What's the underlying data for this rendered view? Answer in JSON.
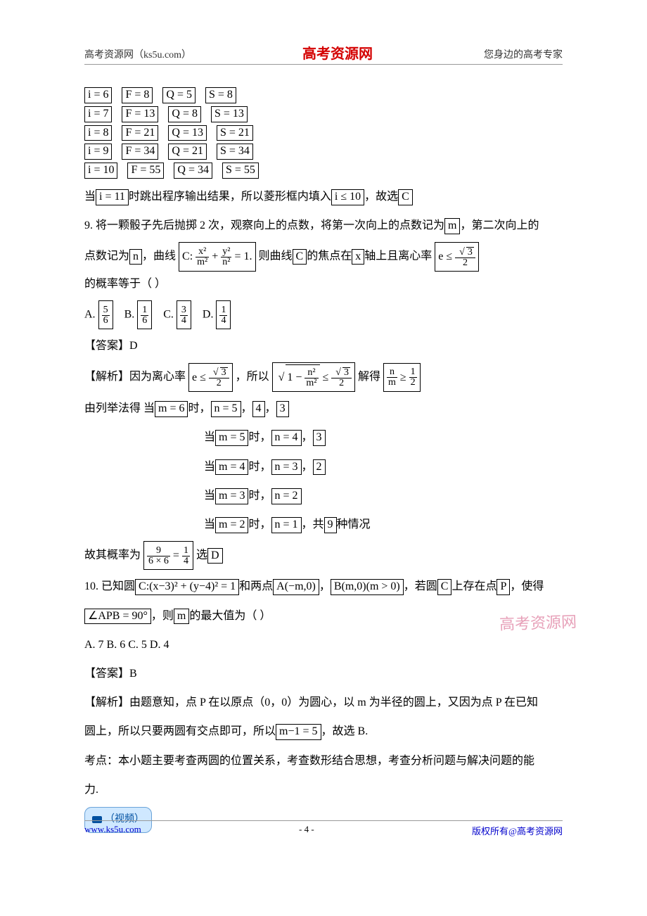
{
  "header": {
    "left": "高考资源网（ks5u.com）",
    "center": "高考资源网",
    "right": "您身边的高考专家"
  },
  "table_rows": [
    {
      "i": "i = 6",
      "f": "F = 8",
      "q": "Q = 5",
      "s": "S = 8"
    },
    {
      "i": "i = 7",
      "f": "F = 13",
      "q": "Q = 8",
      "s": "S = 13"
    },
    {
      "i": "i = 8",
      "f": "F = 21",
      "q": "Q = 13",
      "s": "S = 21"
    },
    {
      "i": "i = 9",
      "f": "F = 34",
      "q": "Q = 21",
      "s": "S = 34"
    },
    {
      "i": "i = 10",
      "f": "F = 55",
      "q": "Q = 34",
      "s": "S = 55"
    }
  ],
  "q8_tail": {
    "prefix": "当",
    "cond": "i = 11",
    "mid1": "时跳出程序输出结果，所以菱形框内填入",
    "cond2": "i ≤ 10",
    "mid2": "，故选",
    "ans": "C"
  },
  "q9": {
    "stem_a": "9.  将一颗骰子先后抛掷 2 次，观察向上的点数，将第一次向上的点数记为",
    "m": "m",
    "stem_b": "，第二次向上的",
    "stem_c": "点数记为",
    "n": "n",
    "stem_d": "，曲线",
    "curve_label": "C:",
    "curve_eq_left_num": "x²",
    "curve_eq_left_den": "m²",
    "plus": "+",
    "curve_eq_right_num": "y²",
    "curve_eq_right_den": "n²",
    "eq1": "= 1.",
    "stem_e": "则曲线",
    "C": "C",
    "stem_f": "的焦点在",
    "x": "x",
    "stem_g": "轴上且离心率",
    "e_le": "e ≤",
    "sqrt3": "3",
    "two": "2",
    "stem_h": "的概率等于（     ）",
    "opts": {
      "A_label": "A.",
      "A_num": "5",
      "A_den": "6",
      "B_label": "B.",
      "B_num": "1",
      "B_den": "6",
      "C_label": "C.",
      "C_num": "3",
      "C_den": "4",
      "D_label": "D.",
      "D_num": "1",
      "D_den": "4"
    },
    "answer_label": "【答案】D",
    "expl_label": "【解析】因为离心率",
    "expl_mid1": "，所以",
    "sqrt_expr_a": "1 −",
    "sqrt_expr_num": "n²",
    "sqrt_expr_den": "m²",
    "le": "≤",
    "expl_mid2": "解得",
    "nm_num": "n",
    "nm_den": "m",
    "ge": "≥",
    "half_num": "1",
    "half_den": "2",
    "enum_lead": "由列举法得  当",
    "m6": "m = 6",
    "n5": "n = 5",
    "extra_45_3": "4，3",
    "dang": "当",
    "shi": "时，",
    "m5": "m = 5",
    "n4": "n = 4",
    "extra_3": "3",
    "m4": "m = 4",
    "n3": "n = 3",
    "extra_2_box": "2",
    "m3": "m = 3",
    "n2": "n = 2",
    "m2": "m = 2",
    "n1": "n = 1",
    "gong": "，共",
    "nine": "9",
    "qingkuang": "种情况",
    "prob_lead": "故其概率为",
    "prob_num": "9",
    "prob_den": "6 × 6",
    "eq_frac_num": "1",
    "eq_frac_den": "4",
    "xuan": " 选",
    "D": "D"
  },
  "q10": {
    "stem_a": "10.  已知圆",
    "circle": "C:(x−3)² + (y−4)² = 1",
    "stem_b": "和两点",
    "A": "A(−m,0)",
    "comma": "，",
    "B": "B(m,0)(m > 0)",
    "stem_c": "，若圆",
    "C": "C",
    "stem_d": "上存在点",
    "P": "P",
    "stem_e": "，使得",
    "angle": "∠APB = 90°",
    "stem_f": "，则",
    "m": "m",
    "stem_g": "的最大值为（     ）",
    "opts": "A. 7     B. 6     C. 5     D. 4",
    "answer": "【答案】B",
    "expl1": "【解析】由题意知，点 P 在以原点（0，0）为圆心，以 m 为半径的圆上，又因为点 P 在已知",
    "expl2_a": "圆上，所以只要两圆有交点即可，所以",
    "cond": "m−1 = 5",
    "expl2_b": "，故选 B.",
    "kaodian": "考点：本小题主要考查两圆的位置关系，考查数形结合思想，考查分析问题与解决问题的能",
    "kaodian2": "力."
  },
  "video_label": "（视频）",
  "watermark": "高考资源网",
  "footer": {
    "url": "www.ks5u.com",
    "page": "- 4 -",
    "copyright": "版权所有@高考资源网"
  }
}
